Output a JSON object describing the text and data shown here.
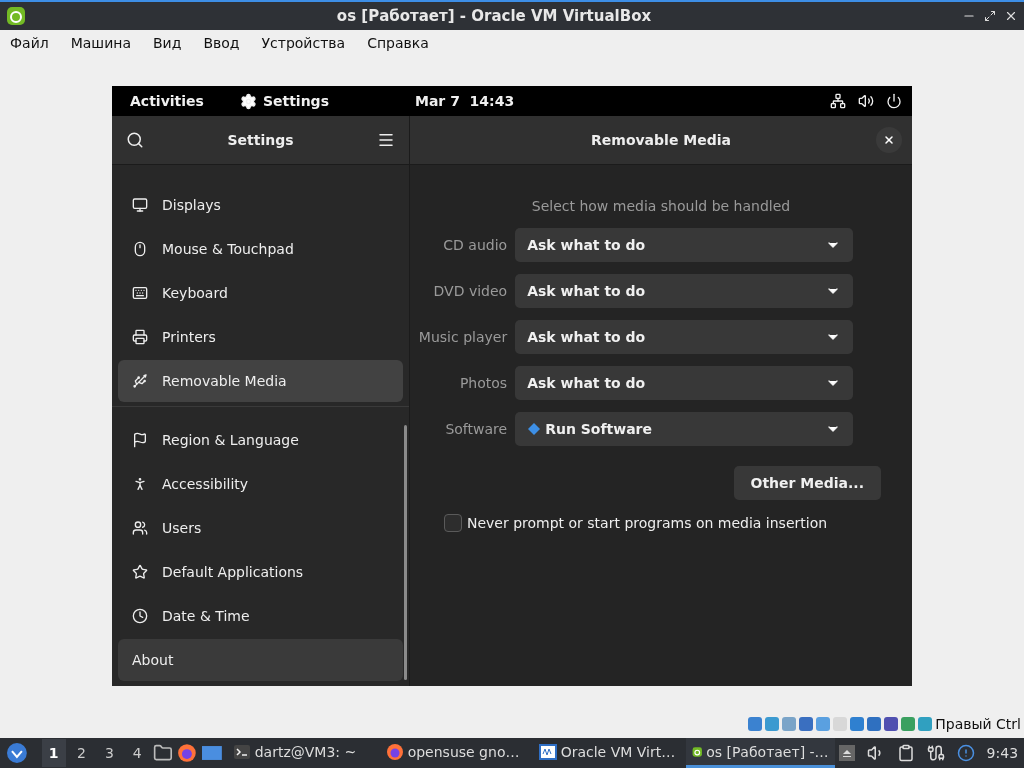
{
  "window": {
    "title": "os [Работает] - Oracle VM VirtualBox"
  },
  "menu": [
    "Файл",
    "Машина",
    "Вид",
    "Ввод",
    "Устройства",
    "Справка"
  ],
  "guest": {
    "top_bar": {
      "activities": "Activities",
      "app": "Settings",
      "clock": "Mar 7  14:43"
    },
    "sidebar": {
      "title": "Settings",
      "items": [
        {
          "kind": "display",
          "label": "Displays",
          "selected": false,
          "hovered": false
        },
        {
          "kind": "mouse",
          "label": "Mouse & Touchpad",
          "selected": false,
          "hovered": false
        },
        {
          "kind": "keyboard",
          "label": "Keyboard",
          "selected": false,
          "hovered": false
        },
        {
          "kind": "printer",
          "label": "Printers",
          "selected": false,
          "hovered": false
        },
        {
          "kind": "usb",
          "label": "Removable Media",
          "selected": true,
          "hovered": false
        },
        {
          "kind": "separator"
        },
        {
          "kind": "flag",
          "label": "Region & Language",
          "selected": false,
          "hovered": false
        },
        {
          "kind": "person",
          "label": "Accessibility",
          "selected": false,
          "hovered": false
        },
        {
          "kind": "users",
          "label": "Users",
          "selected": false,
          "hovered": false
        },
        {
          "kind": "star",
          "label": "Default Applications",
          "selected": false,
          "hovered": false
        },
        {
          "kind": "clock",
          "label": "Date & Time",
          "selected": false,
          "hovered": false
        },
        {
          "kind": "none",
          "label": "About",
          "selected": false,
          "hovered": true
        }
      ]
    },
    "panel": {
      "title": "Removable Media",
      "hint": "Select how media should be handled",
      "rows": [
        {
          "label": "CD audio",
          "value": "Ask what to do",
          "kind": "plain"
        },
        {
          "label": "DVD video",
          "value": "Ask what to do",
          "kind": "plain"
        },
        {
          "label": "Music player",
          "value": "Ask what to do",
          "kind": "plain"
        },
        {
          "label": "Photos",
          "value": "Ask what to do",
          "kind": "plain"
        },
        {
          "label": "Software",
          "value": "Run Software",
          "kind": "app"
        }
      ],
      "other_button": "Other Media...",
      "never_prompt": {
        "label": "Never prompt or start programs on media insertion",
        "checked": false
      }
    }
  },
  "host_status": {
    "key": "Правый Ctrl"
  },
  "taskbar": {
    "workspaces": [
      {
        "label": "1",
        "selected": true
      },
      {
        "label": "2",
        "selected": false
      },
      {
        "label": "3",
        "selected": false
      },
      {
        "label": "4",
        "selected": false
      }
    ],
    "tasks": [
      {
        "kind": "terminal",
        "label": "dartz@VM3: ~",
        "selected": false
      },
      {
        "kind": "browser",
        "label": "opensuse gno…",
        "selected": false
      },
      {
        "kind": "vbox",
        "label": "Oracle VM Virt…",
        "selected": false
      },
      {
        "kind": "vm",
        "label": "os [Работает] -…",
        "selected": true
      }
    ],
    "time": "9:43"
  }
}
